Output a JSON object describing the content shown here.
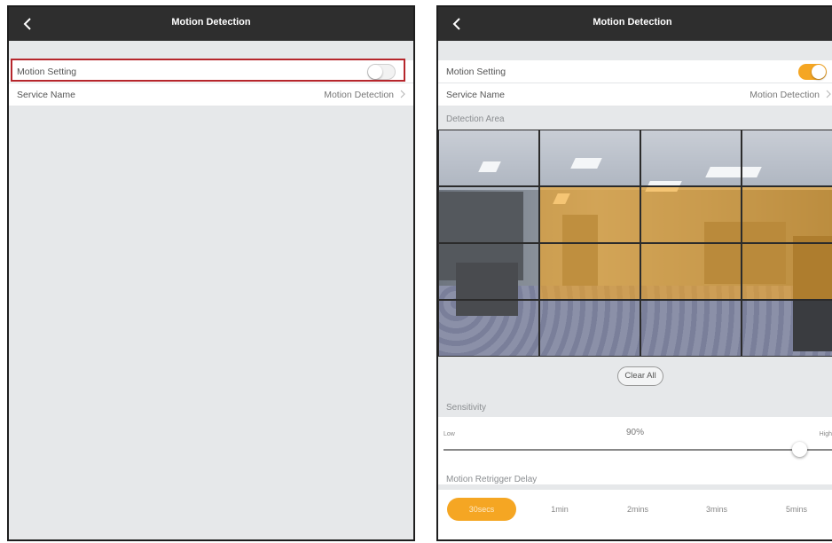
{
  "left_screen": {
    "title": "Motion Detection",
    "motion_setting_label": "Motion Setting",
    "motion_setting_on": false,
    "service_name_label": "Service Name",
    "service_name_value": "Motion Detection"
  },
  "right_screen": {
    "title": "Motion Detection",
    "motion_setting_label": "Motion Setting",
    "motion_setting_on": true,
    "service_name_label": "Service Name",
    "service_name_value": "Motion Detection",
    "detection_area_label": "Detection Area",
    "detection_grid": {
      "rows": 4,
      "cols": 4,
      "selected": [
        [
          1,
          1
        ],
        [
          1,
          2
        ],
        [
          1,
          3
        ],
        [
          2,
          1
        ],
        [
          2,
          2
        ],
        [
          2,
          3
        ]
      ]
    },
    "clear_all_label": "Clear All",
    "sensitivity_label": "Sensitivity",
    "sensitivity_low": "Low",
    "sensitivity_high": "High",
    "sensitivity_value_text": "90%",
    "sensitivity_fraction": 0.9,
    "retrigger_label": "Motion Retrigger Delay",
    "delay_options": [
      "30secs",
      "1min",
      "2mins",
      "3mins",
      "5mins"
    ],
    "delay_selected_index": 0
  },
  "colors": {
    "accent": "#f5a623",
    "highlight": "#b6262c",
    "topbar": "#2e2e2e",
    "background": "#e6e8ea"
  },
  "icons": [
    "back-chevron-icon",
    "chevron-right-icon"
  ]
}
